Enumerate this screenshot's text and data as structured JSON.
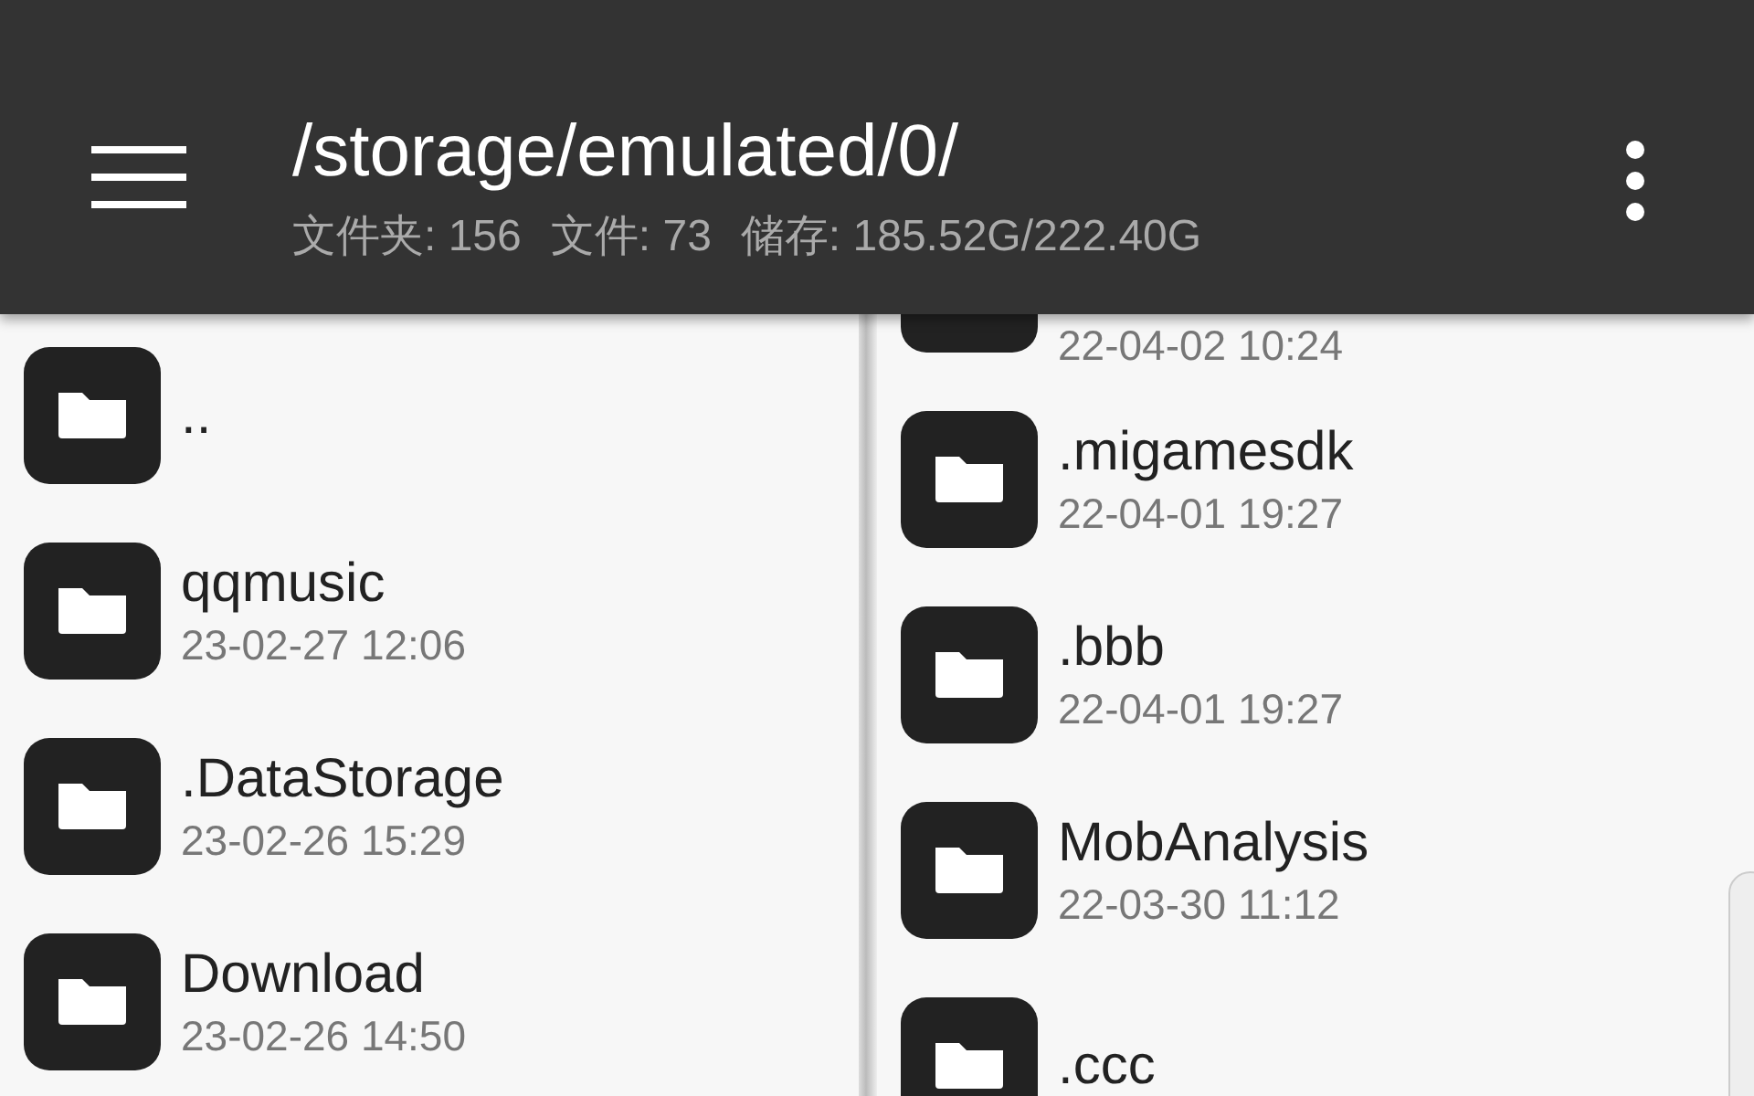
{
  "app_bar": {
    "path": "/storage/emulated/0/",
    "summary": [
      "文件夹: 156",
      "文件: 73",
      "储存: 185.52G/222.40G"
    ]
  },
  "panes": [
    {
      "items": [
        {
          "name": ".."
        },
        {
          "name": "qqmusic",
          "date": "23-02-27 12:06"
        },
        {
          "name": ".DataStorage",
          "date": "23-02-26 15:29"
        },
        {
          "name": "Download",
          "date": "23-02-26 14:50"
        }
      ]
    },
    {
      "items": [
        {
          "date": "22-04-02 10:24"
        },
        {
          "name": ".migamesdk",
          "date": "22-04-01 19:27"
        },
        {
          "name": ".bbb",
          "date": "22-04-01 19:27"
        },
        {
          "name": "MobAnalysis",
          "date": "22-03-30 11:12"
        },
        {
          "name": ".ccc"
        }
      ]
    }
  ]
}
